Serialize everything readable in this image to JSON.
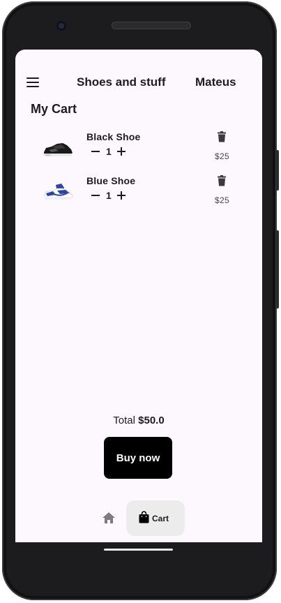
{
  "app": {
    "title": "Shoes and stuff",
    "user": "Mateus"
  },
  "cart": {
    "heading": "My Cart",
    "items": [
      {
        "name": "Black Shoe",
        "quantity": "1",
        "price": "$25",
        "image": "black-sneaker"
      },
      {
        "name": "Blue Shoe",
        "quantity": "1",
        "price": "$25",
        "image": "blue-sneaker"
      }
    ],
    "total_label": "Total",
    "total_value": "$50.0",
    "buy_label": "Buy now"
  },
  "bottom_nav": {
    "home_icon": "home-icon",
    "cart_icon": "shopping-bag-icon",
    "cart_label": "Cart"
  },
  "colors": {
    "background": "#fdf8fd",
    "primary_button": "#000000",
    "selected_nav": "#ececec",
    "text": "#1d1b20"
  }
}
